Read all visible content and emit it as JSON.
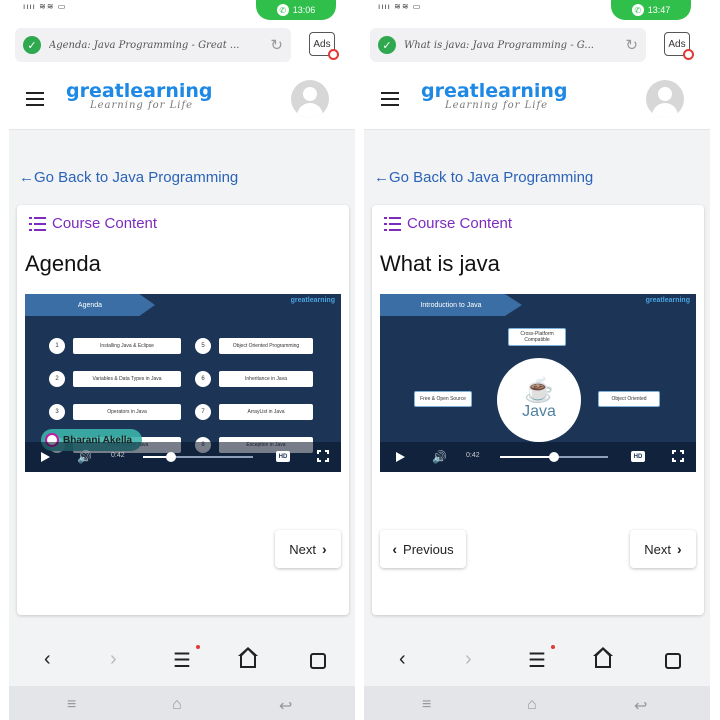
{
  "screens": [
    {
      "status": {
        "left": "ıııı ≋≋ ▭",
        "call_time": "13:06"
      },
      "browser": {
        "url": "Agenda: Java Programming - Great ...",
        "ads_label": "Ads"
      },
      "header": {
        "logo": "greatlearning",
        "tagline": "Learning for Life"
      },
      "back_link": "Go Back to Java Programming",
      "course_content": "Course Content",
      "lesson_title": "Agenda",
      "video": {
        "banner": "Agenda",
        "brand": "greatlearning",
        "items_left": [
          {
            "num": "1",
            "text": "Installing Java & Eclipse"
          },
          {
            "num": "2",
            "text": "Variables & Data Types in Java"
          },
          {
            "num": "3",
            "text": "Operators in Java"
          },
          {
            "num": "4",
            "text": "Statements in Java"
          }
        ],
        "items_right": [
          {
            "num": "5",
            "text": "Object Oriented Programming"
          },
          {
            "num": "6",
            "text": "Inheritance in Java"
          },
          {
            "num": "7",
            "text": "ArrayList in Java"
          },
          {
            "num": "8",
            "text": "Exception in Java"
          }
        ],
        "watermark": "Bharani Akella",
        "time": "0:42",
        "hd": "HD",
        "progress": 0.25
      },
      "next_label": "Next"
    },
    {
      "status": {
        "left": "ıııı ≋≋ ▭",
        "call_time": "13:47"
      },
      "browser": {
        "url": "What is java: Java Programming - G...",
        "ads_label": "Ads"
      },
      "header": {
        "logo": "greatlearning",
        "tagline": "Learning for Life"
      },
      "back_link": "Go Back to Java Programming",
      "course_content": "Course Content",
      "lesson_title": "What is java",
      "video": {
        "banner": "Introduction to Java",
        "brand": "greatlearning",
        "java_word": "Java",
        "box_top": "Cross-Platform Compatible",
        "box_left": "Free & Open Source",
        "box_right": "Object Oriented",
        "time": "0:42",
        "hd": "HD",
        "progress": 0.5
      },
      "previous_label": "Previous",
      "next_label": "Next"
    }
  ]
}
